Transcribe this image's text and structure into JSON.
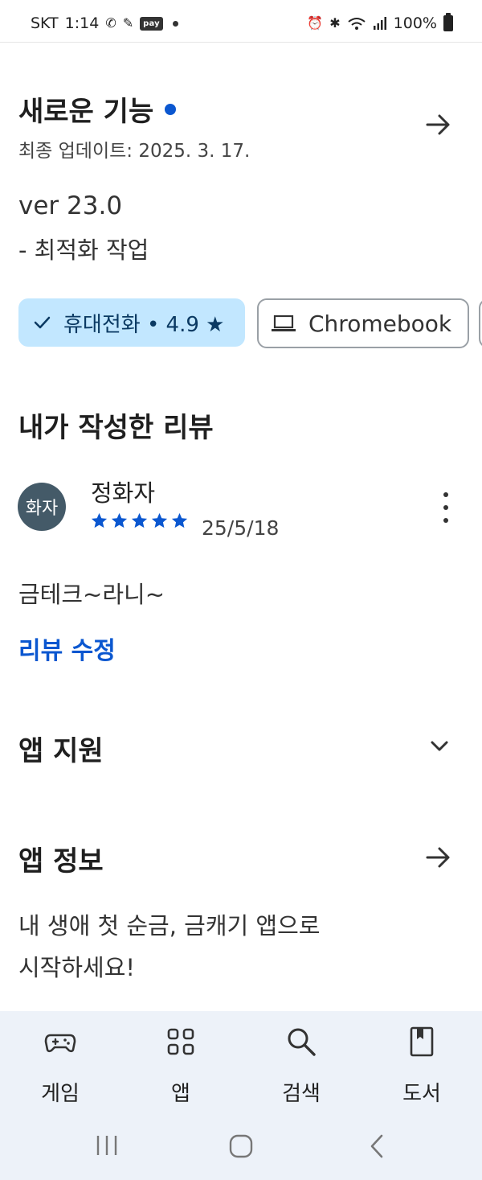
{
  "status_bar": {
    "carrier": "SKT",
    "time": "1:14",
    "pay_badge": "pay",
    "battery": "100%"
  },
  "whats_new": {
    "title": "새로운 기능",
    "updated": "최종 업데이트: 2025. 3. 17.",
    "version": "ver 23.0",
    "note": "- 최적화 작업"
  },
  "device_chips": {
    "phone_label": "휴대전화 • 4.9 ★",
    "laptop_label": "Chromebook"
  },
  "my_review": {
    "title": "내가 작성한 리뷰",
    "avatar_text": "화자",
    "reviewer_name": "정화자",
    "rating": 5,
    "date": "25/5/18",
    "text": "금테크~라니~",
    "edit_label": "리뷰 수정"
  },
  "app_support": {
    "title": "앱 지원"
  },
  "app_info": {
    "title": "앱 정보",
    "desc_line1": "내 생애 첫 순금, 금캐기 앱으로",
    "desc_line2": "시작하세요!"
  },
  "bottom_nav": {
    "items": [
      {
        "label": "게임",
        "icon": "gamepad-icon"
      },
      {
        "label": "앱",
        "icon": "apps-grid-icon"
      },
      {
        "label": "검색",
        "icon": "search-icon"
      },
      {
        "label": "도서",
        "icon": "book-icon"
      }
    ]
  },
  "colors": {
    "accent": "#0b57d0",
    "chip_selected_bg": "#c2e7ff",
    "avatar_bg": "#445a68",
    "nav_bg": "#edf2f9"
  }
}
